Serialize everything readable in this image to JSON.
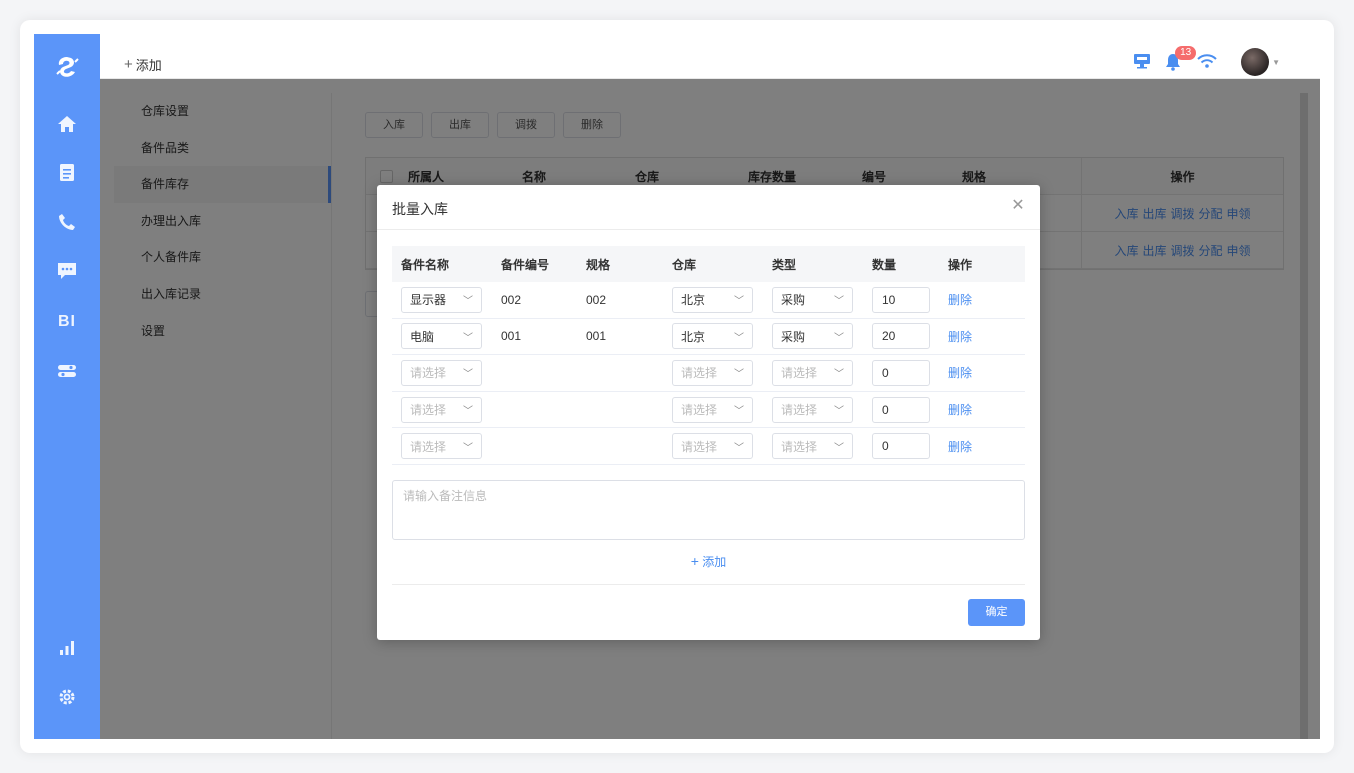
{
  "topbar": {
    "add_label": "添加",
    "notification_count": "13"
  },
  "submenu": {
    "items": [
      {
        "label": "仓库设置"
      },
      {
        "label": "备件品类"
      },
      {
        "label": "备件库存"
      },
      {
        "label": "办理出入库"
      },
      {
        "label": "个人备件库"
      },
      {
        "label": "出入库记录"
      },
      {
        "label": "设置"
      }
    ]
  },
  "toolbar": {
    "in_label": "入库",
    "out_label": "出库",
    "transfer_label": "调拨",
    "delete_label": "删除"
  },
  "inventory_table": {
    "headers": [
      "所属人",
      "名称",
      "仓库",
      "库存数量",
      "编号",
      "规格",
      "操作"
    ],
    "row_ops": [
      "入库",
      "出库",
      "调拨",
      "分配",
      "申领"
    ]
  },
  "modal": {
    "title": "批量入库",
    "headers": [
      "备件名称",
      "备件编号",
      "规格",
      "仓库",
      "类型",
      "数量",
      "操作"
    ],
    "rows": [
      {
        "name": "显示器",
        "code": "002",
        "spec": "002",
        "warehouse": "北京",
        "type": "采购",
        "qty": "10",
        "op": "删除"
      },
      {
        "name": "电脑",
        "code": "001",
        "spec": "001",
        "warehouse": "北京",
        "type": "采购",
        "qty": "20",
        "op": "删除"
      },
      {
        "name": "请选择",
        "code": "",
        "spec": "",
        "warehouse": "请选择",
        "type": "请选择",
        "qty": "0",
        "op": "删除"
      },
      {
        "name": "请选择",
        "code": "",
        "spec": "",
        "warehouse": "请选择",
        "type": "请选择",
        "qty": "0",
        "op": "删除"
      },
      {
        "name": "请选择",
        "code": "",
        "spec": "",
        "warehouse": "请选择",
        "type": "请选择",
        "qty": "0",
        "op": "删除"
      }
    ],
    "remark_placeholder": "请输入备注信息",
    "add_label": "添加",
    "confirm_label": "确定"
  },
  "colors": {
    "accent": "#5b95f9",
    "link": "#4a8ef0",
    "badge": "#f56c6c"
  }
}
